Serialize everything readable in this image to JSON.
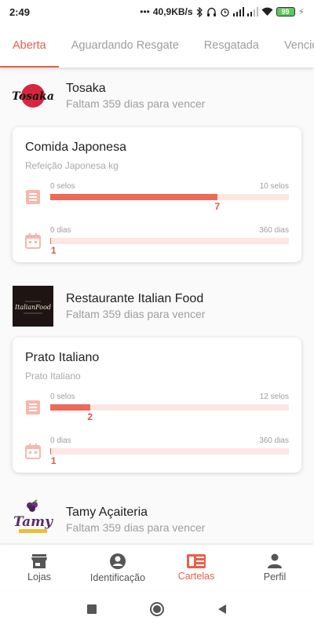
{
  "status": {
    "time": "2:49",
    "network": "40,9KB/s",
    "battery": "99"
  },
  "tabs": [
    {
      "label": "Aberta"
    },
    {
      "label": "Aguardando Resgate"
    },
    {
      "label": "Resgatada"
    },
    {
      "label": "Vencidas"
    }
  ],
  "stores": [
    {
      "name": "Tosaka",
      "subtitle": "Faltam 359 dias para vencer",
      "logo_text": "Tosaka",
      "card": {
        "title": "Comida Japonesa",
        "subtitle": "Refeição Japonesa kg",
        "stamps": {
          "min_label": "0 selos",
          "max_label": "10 selos",
          "value": "7",
          "fraction": 0.7
        },
        "days": {
          "min_label": "0 dias",
          "max_label": "360 dias",
          "value": "1",
          "fraction": 0.003
        }
      }
    },
    {
      "name": "Restaurante Italian Food",
      "subtitle": "Faltam 359 dias para vencer",
      "logo_text": "ItalianFood",
      "card": {
        "title": "Prato Italiano",
        "subtitle": "Prato Italiano",
        "stamps": {
          "min_label": "0 selos",
          "max_label": "12 selos",
          "value": "2",
          "fraction": 0.167
        },
        "days": {
          "min_label": "0 dias",
          "max_label": "360 dias",
          "value": "1",
          "fraction": 0.003
        }
      }
    },
    {
      "name": "Tamy Açaiteria",
      "subtitle": "Faltam 359 dias para vencer",
      "logo_text": "Tamy"
    }
  ],
  "bottom_nav": [
    {
      "label": "Lojas",
      "icon": "store-icon"
    },
    {
      "label": "Identificação",
      "icon": "account-circle-icon"
    },
    {
      "label": "Cartelas",
      "icon": "card-icon"
    },
    {
      "label": "Perfil",
      "icon": "person-icon"
    }
  ],
  "colors": {
    "accent": "#e8604c",
    "bar_fill": "#ec6b58",
    "bar_track": "#fde7e3"
  }
}
